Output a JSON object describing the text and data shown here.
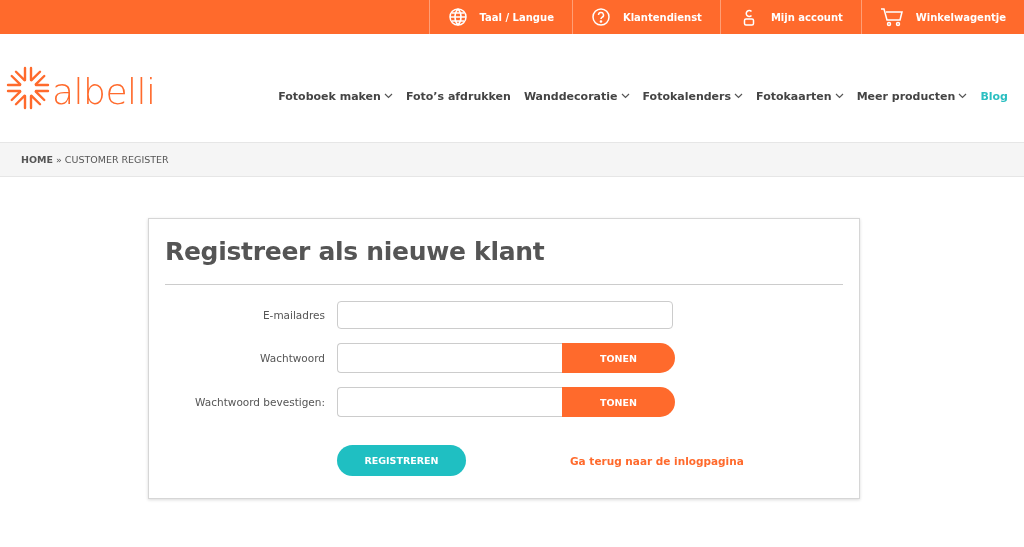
{
  "top_bar": [
    {
      "kind": "globe",
      "label": "Taal / Langue"
    },
    {
      "kind": "help",
      "label": "Klantendienst"
    },
    {
      "kind": "user",
      "label": "Mijn account"
    },
    {
      "kind": "cart",
      "label": "Winkelwagentje"
    }
  ],
  "logo": {
    "text": "albelli"
  },
  "nav": [
    {
      "label": "Fotoboek maken",
      "kind": "menu",
      "highlighted": false
    },
    {
      "label": "Foto’s afdrukken",
      "kind": "link",
      "highlighted": false
    },
    {
      "label": "Wanddecoratie",
      "kind": "menu",
      "highlighted": false
    },
    {
      "label": "Fotokalenders",
      "kind": "menu",
      "highlighted": false
    },
    {
      "label": "Fotokaarten",
      "kind": "menu",
      "highlighted": false
    },
    {
      "label": "Meer producten",
      "kind": "menu",
      "highlighted": false
    },
    {
      "label": "Blog",
      "kind": "link",
      "highlighted": true
    }
  ],
  "breadcrumb": {
    "home": "HOME",
    "separator": "»",
    "current": "CUSTOMER REGISTER"
  },
  "form": {
    "title": "Registreer als nieuwe klant",
    "fields": [
      {
        "label": "E-mailadres",
        "kind": "email"
      },
      {
        "label": "Wachtwoord",
        "kind": "password",
        "button": "TONEN"
      },
      {
        "label": "Wachtwoord bevestigen:",
        "kind": "password",
        "button": "TONEN"
      }
    ],
    "submit": "REGISTREREN",
    "back_link": "Ga terug naar de inlogpagina"
  }
}
